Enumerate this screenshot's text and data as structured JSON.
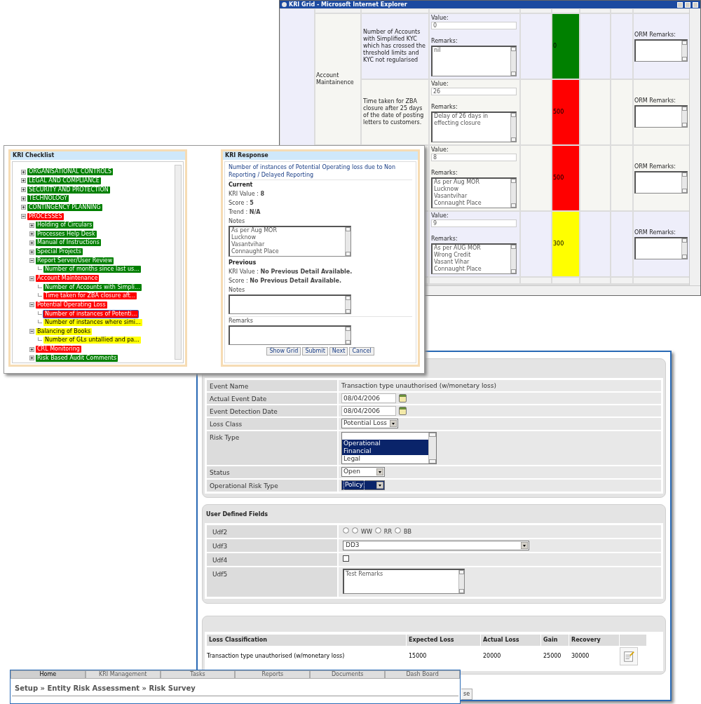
{
  "kri_grid_window": {
    "title": "KRI Grid - Microsoft Internet Explorer",
    "groups": [
      {
        "label": "Account Maintainence",
        "rows": [
          {
            "description": "Number of Accounts with Simplified KYC which has crossed the threshold limits and KYC not regularised",
            "value_label": "Value:",
            "value": "0",
            "remarks_label": "Remarks:",
            "remarks": "nil",
            "score": "0",
            "color": "#008000",
            "orm_label": "ORM Remarks:"
          },
          {
            "description": "Time taken for ZBA closure after 25 days of the date of posting letters to customers.",
            "value_label": "Value:",
            "value": "26",
            "remarks_label": "Remarks:",
            "remarks": "Delay of 26 days in effecting closure",
            "score": "500",
            "color": "#ff0000",
            "orm_label": "ORM Remarks:"
          }
        ]
      },
      {
        "rows": [
          {
            "value_label": "Value:",
            "value": "8",
            "remarks_label": "Remarks:",
            "remarks": "As per Aug MOR\nLucknow\nVasantvihar\nConnaught Place",
            "score": "500",
            "color": "#ff0000",
            "orm_label": "ORM Remarks:"
          },
          {
            "value_label": "Value:",
            "value": "9",
            "remarks_label": "Remarks:",
            "remarks": "As per AUG MOR\nWrong Credit\nVasant Vihar\nConnaught Place",
            "score": "300",
            "color": "#ffff00",
            "orm_label": "ORM Remarks:"
          }
        ]
      }
    ]
  },
  "kri_checklist": {
    "title": "KRI Checklist",
    "tree": [
      {
        "label": "ORGANISATIONAL CONTROLS",
        "color": "#008000",
        "expanded": false,
        "selected": false
      },
      {
        "label": "LEGAL AND COMPLIANCE",
        "color": "#008000",
        "expanded": false,
        "selected": false
      },
      {
        "label": "SECURITY AND PROTECTION",
        "color": "#008000",
        "expanded": false,
        "selected": false
      },
      {
        "label": "TECHNOLOGY",
        "color": "#008000",
        "expanded": false,
        "selected": false
      },
      {
        "label": "CONTINGENCY PLANNING",
        "color": "#008000",
        "expanded": false,
        "selected": false
      },
      {
        "label": "PROCESSES",
        "color": "#ff0000",
        "expanded": true,
        "selected": false,
        "children": [
          {
            "label": "Holding of Circulars",
            "color": "#008000",
            "expanded": false,
            "selected": false
          },
          {
            "label": "Processes Help Desk",
            "color": "#008000",
            "expanded": false,
            "selected": false
          },
          {
            "label": "Manual of Instructions",
            "color": "#008000",
            "expanded": false,
            "selected": false
          },
          {
            "label": "Special Projects",
            "color": "#008000",
            "expanded": false,
            "selected": false
          },
          {
            "label": "Report Server/User Review",
            "color": "#008000",
            "expanded": true,
            "selected": false,
            "children": [
              {
                "label": "Number of months since last us...",
                "color": "#008000",
                "selected": false
              }
            ]
          },
          {
            "label": "Account Maintenance",
            "color": "#ff0000",
            "expanded": true,
            "selected": false,
            "children": [
              {
                "label": "Number of Accounts with Simpli...",
                "color": "#008000",
                "selected": false
              },
              {
                "label": "Time taken for ZBA closure aft...",
                "color": "#ff0000",
                "selected": false
              }
            ]
          },
          {
            "label": "Potential Operating Loss",
            "color": "#ff0000",
            "expanded": true,
            "selected": false,
            "children": [
              {
                "label": "Number of instances of Potenti...",
                "color": "#ff0000",
                "selected": true
              },
              {
                "label": "Number of instances where simi...",
                "color": "#ffff00",
                "selected": false
              }
            ]
          },
          {
            "label": "Balancing of Books",
            "color": "#ffff00",
            "expanded": true,
            "selected": false,
            "children": [
              {
                "label": "Number of GLs untallied and pa...",
                "color": "#ffff00",
                "selected": false
              }
            ]
          },
          {
            "label": "CRL Monitoring",
            "color": "#ff0000",
            "expanded": false,
            "selected": false
          },
          {
            "label": "Risk Based Audit Comments",
            "color": "#008000",
            "expanded": false,
            "selected": false
          }
        ]
      }
    ]
  },
  "kri_response": {
    "title": "KRI Response",
    "heading": "Number of instances of Potential Operating loss due to Non Reporting / Delayed Reporting",
    "current": {
      "title": "Current",
      "lines": [
        "KRI Value : **8**",
        "Score : **5**",
        "Trend : **N/A**"
      ],
      "notes_label": "Notes",
      "notes": "As per Aug MOR\nLucknow\nVasantvihar\nConnaught Place"
    },
    "previous": {
      "title": "Previous",
      "lines": [
        "KRI Value : **No Previous Detail Available.**",
        "Score : **No Previous Detail Available.**"
      ],
      "notes_label": "Notes"
    },
    "remarks_label": "Remarks",
    "buttons": [
      "Show Grid",
      "Submit",
      "Next",
      "Cancel"
    ]
  },
  "event_form": {
    "rows": [
      {
        "label": "Event Name",
        "kind": "text",
        "value": "Transaction type unauthorised (w/monetary loss)"
      },
      {
        "label": "Actual Event Date",
        "kind": "date",
        "value": "08/04/2006"
      },
      {
        "label": "Event Detection Date",
        "kind": "date",
        "value": "08/04/2006"
      },
      {
        "label": "Loss Class",
        "kind": "select",
        "value": "Potential Loss",
        "highlighted": false
      },
      {
        "label": "Risk Type",
        "kind": "listbox",
        "options": [
          {
            "label": "Operational",
            "selected": true
          },
          {
            "label": "Financial",
            "selected": true
          },
          {
            "label": "Legal",
            "selected": false
          }
        ]
      },
      {
        "label": "Status",
        "kind": "select",
        "value": "Open",
        "highlighted": false
      },
      {
        "label": "Operational Risk Type",
        "kind": "select",
        "value": "Policy",
        "highlighted": true
      }
    ]
  },
  "user_defined_fields": {
    "title": "User Defined Fields",
    "rows": [
      {
        "label": "Udf2",
        "kind": "radios",
        "options": [
          {
            "checked": false
          },
          {
            "label": "WW",
            "checked": false
          },
          {
            "label": "RR",
            "checked": false
          },
          {
            "label": "BB",
            "checked": false
          }
        ]
      },
      {
        "label": "Udf3",
        "kind": "select",
        "value": "DD3"
      },
      {
        "label": "Udf4",
        "kind": "checkbox",
        "checked": false
      },
      {
        "label": "Udf5",
        "kind": "textarea",
        "value": "Test Remarks"
      }
    ]
  },
  "loss_table": {
    "columns": [
      "Loss Classification",
      "Expected Loss",
      "Actual Loss",
      "Gain",
      "Recovery"
    ],
    "rows": [
      {
        "cells": [
          "Transaction type unauthorised (w/monetary loss)",
          "15000",
          "20000",
          "25000",
          "30000"
        ]
      }
    ]
  },
  "partial_button": "se",
  "nav_window": {
    "tabs": [
      {
        "label": "Home",
        "selected": true
      },
      {
        "label": "KRI Management",
        "selected": false
      },
      {
        "label": "Tasks",
        "selected": false
      },
      {
        "label": "Reports",
        "selected": false
      },
      {
        "label": "Documents",
        "selected": false
      },
      {
        "label": "Dash Board",
        "selected": false
      }
    ],
    "breadcrumb": "Setup » Entity Risk Assessment » Risk Survey"
  }
}
